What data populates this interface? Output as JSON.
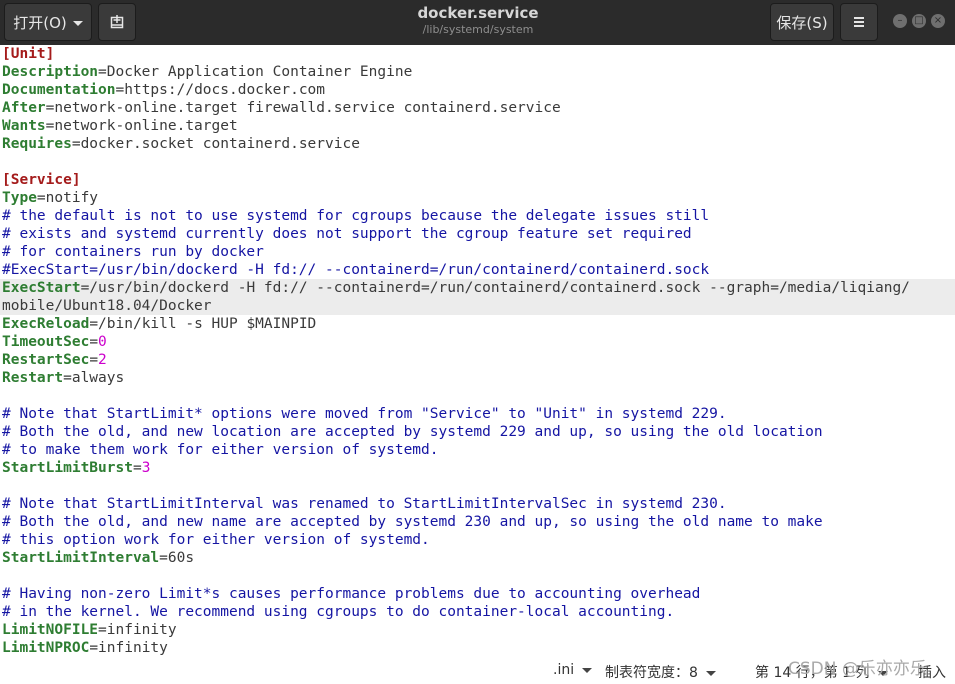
{
  "header": {
    "open_label": "打开(O)",
    "title": "docker.service",
    "subtitle": "/lib/systemd/system",
    "save_label": "保存(S)",
    "newdoc_icon": "new-document-icon",
    "menu_icon": "hamburger-menu-icon"
  },
  "editor": {
    "lines": [
      {
        "sec": "[Unit]"
      },
      {
        "key": "Description",
        "val": "=Docker Application Container Engine"
      },
      {
        "key": "Documentation",
        "val": "=https://docs.docker.com"
      },
      {
        "key": "After",
        "val": "=network-online.target firewalld.service containerd.service"
      },
      {
        "key": "Wants",
        "val": "=network-online.target"
      },
      {
        "key": "Requires",
        "val": "=docker.socket containerd.service"
      },
      {
        "blank": ""
      },
      {
        "sec": "[Service]"
      },
      {
        "key": "Type",
        "val": "=notify"
      },
      {
        "cmt": "# the default is not to use systemd for cgroups because the delegate issues still"
      },
      {
        "cmt": "# exists and systemd currently does not support the cgroup feature set required"
      },
      {
        "cmt": "# for containers run by docker"
      },
      {
        "cmt": "#ExecStart=/usr/bin/dockerd -H fd:// --containerd=/run/containerd/containerd.sock"
      },
      {
        "key": "ExecStart",
        "val": "=/usr/bin/dockerd -H fd:// --containerd=/run/containerd/containerd.sock --graph=/media/liqiang/",
        "current": true
      },
      {
        "val_only": "mobile/Ubunt18.04/Docker",
        "current": true
      },
      {
        "key": "ExecReload",
        "val": "=/bin/kill -s HUP $MAINPID"
      },
      {
        "key": "TimeoutSec",
        "eq": "=",
        "num": "0"
      },
      {
        "key": "RestartSec",
        "eq": "=",
        "num": "2"
      },
      {
        "key": "Restart",
        "val": "=always"
      },
      {
        "blank": ""
      },
      {
        "cmt": "# Note that StartLimit* options were moved from \"Service\" to \"Unit\" in systemd 229."
      },
      {
        "cmt": "# Both the old, and new location are accepted by systemd 229 and up, so using the old location"
      },
      {
        "cmt": "# to make them work for either version of systemd."
      },
      {
        "key": "StartLimitBurst",
        "eq": "=",
        "num": "3"
      },
      {
        "blank": ""
      },
      {
        "cmt": "# Note that StartLimitInterval was renamed to StartLimitIntervalSec in systemd 230."
      },
      {
        "cmt": "# Both the old, and new name are accepted by systemd 230 and up, so using the old name to make"
      },
      {
        "cmt": "# this option work for either version of systemd."
      },
      {
        "key": "StartLimitInterval",
        "val": "=60s"
      },
      {
        "blank": ""
      },
      {
        "cmt": "# Having non-zero Limit*s causes performance problems due to accounting overhead"
      },
      {
        "cmt": "# in the kernel. We recommend using cgroups to do container-local accounting."
      },
      {
        "key": "LimitNOFILE",
        "val": "=infinity"
      },
      {
        "key": "LimitNPROC",
        "val": "=infinity"
      }
    ]
  },
  "statusbar": {
    "language": ".ini",
    "tab_width": "制表符宽度：8",
    "position": "第 14 行，第 1 列",
    "insert_mode": "插入"
  },
  "watermark": "CSDN @乐亦亦乐",
  "colors": {
    "section": "#a41b1b",
    "key": "#2e7d32",
    "comment": "#1515a3",
    "number": "#cc00cc",
    "header_bg": "#2b2b2b",
    "current_line": "#ececec"
  }
}
